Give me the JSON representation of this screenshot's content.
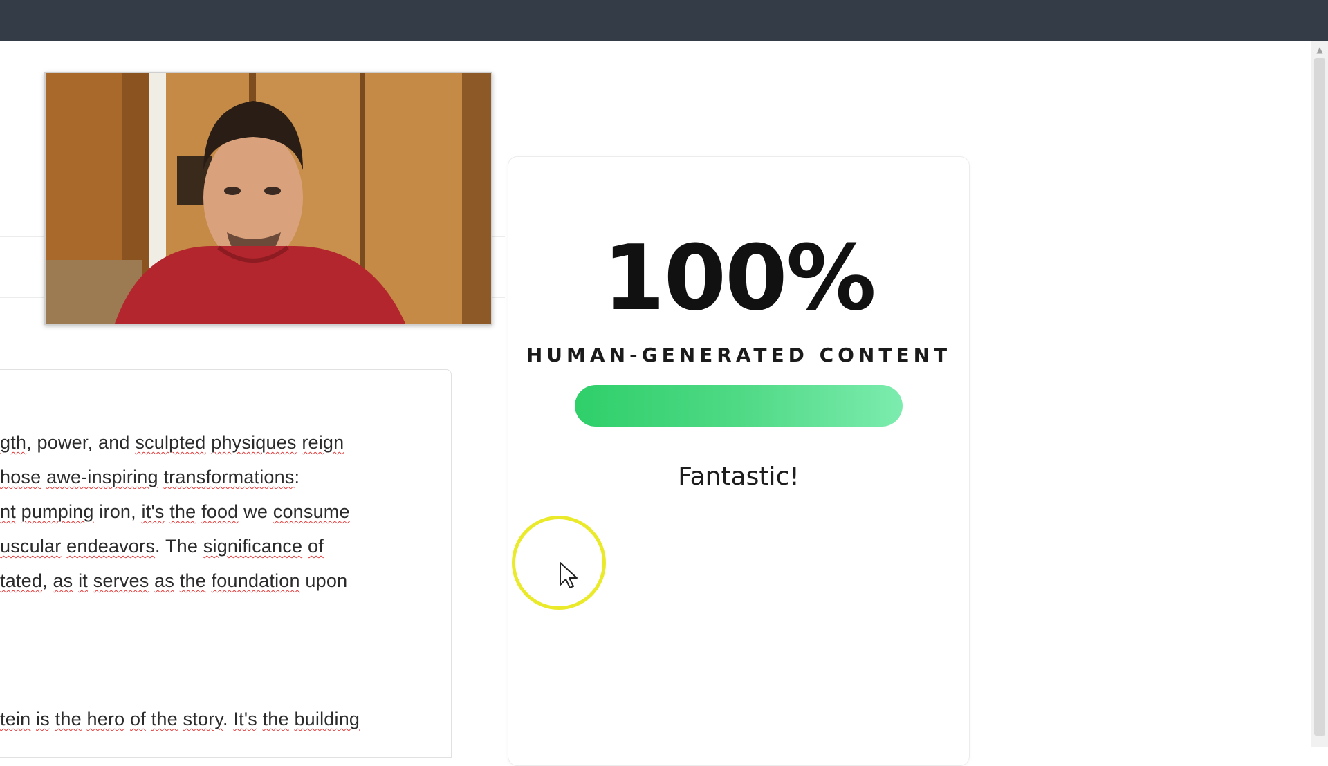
{
  "browser": {
    "topbar_color": "#343d47"
  },
  "editor": {
    "lines": [
      [
        {
          "t": "gth",
          "u": true
        },
        {
          "t": ", power, and ",
          "u": false
        },
        {
          "t": "sculpted",
          "u": true
        },
        {
          "t": " ",
          "u": false
        },
        {
          "t": "physiques",
          "u": true
        },
        {
          "t": " ",
          "u": false
        },
        {
          "t": "reign",
          "u": true
        }
      ],
      [
        {
          "t": "hose",
          "u": true
        },
        {
          "t": " ",
          "u": false
        },
        {
          "t": "awe-inspiring",
          "u": true
        },
        {
          "t": " ",
          "u": false
        },
        {
          "t": "transformations",
          "u": true
        },
        {
          "t": ":",
          "u": false
        }
      ],
      [
        {
          "t": "nt",
          "u": true
        },
        {
          "t": " ",
          "u": false
        },
        {
          "t": "pumping",
          "u": true
        },
        {
          "t": " iron, ",
          "u": false
        },
        {
          "t": "it's",
          "u": true
        },
        {
          "t": " ",
          "u": false
        },
        {
          "t": "the",
          "u": true
        },
        {
          "t": " ",
          "u": false
        },
        {
          "t": "food",
          "u": true
        },
        {
          "t": " we ",
          "u": false
        },
        {
          "t": "consume",
          "u": true
        }
      ],
      [
        {
          "t": "uscular",
          "u": true
        },
        {
          "t": " ",
          "u": false
        },
        {
          "t": "endeavors",
          "u": true
        },
        {
          "t": ". The ",
          "u": false
        },
        {
          "t": "significance",
          "u": true
        },
        {
          "t": " ",
          "u": false
        },
        {
          "t": "of",
          "u": true
        }
      ],
      [
        {
          "t": "tated",
          "u": true
        },
        {
          "t": ", ",
          "u": false
        },
        {
          "t": "as",
          "u": true
        },
        {
          "t": " ",
          "u": false
        },
        {
          "t": "it",
          "u": true
        },
        {
          "t": " ",
          "u": false
        },
        {
          "t": "serves",
          "u": true
        },
        {
          "t": " ",
          "u": false
        },
        {
          "t": "as",
          "u": true
        },
        {
          "t": " ",
          "u": false
        },
        {
          "t": "the",
          "u": true
        },
        {
          "t": " ",
          "u": false
        },
        {
          "t": "foundation",
          "u": true
        },
        {
          "t": " upon",
          "u": false
        }
      ],
      [
        {
          "t": "tein",
          "u": true
        },
        {
          "t": " ",
          "u": false
        },
        {
          "t": "is",
          "u": true
        },
        {
          "t": " ",
          "u": false
        },
        {
          "t": "the",
          "u": true
        },
        {
          "t": " ",
          "u": false
        },
        {
          "t": "hero",
          "u": true
        },
        {
          "t": " ",
          "u": false
        },
        {
          "t": "of",
          "u": true
        },
        {
          "t": " ",
          "u": false
        },
        {
          "t": "the",
          "u": true
        },
        {
          "t": " ",
          "u": false
        },
        {
          "t": "story",
          "u": true
        },
        {
          "t": ". ",
          "u": false
        },
        {
          "t": "It's",
          "u": true
        },
        {
          "t": " ",
          "u": false
        },
        {
          "t": "the",
          "u": true
        },
        {
          "t": " ",
          "u": false
        },
        {
          "t": "building",
          "u": true
        }
      ]
    ]
  },
  "result": {
    "score": "100%",
    "label": "HUMAN-GENERATED CONTENT",
    "bar_level": 1.0,
    "bar_color": "#3fd57a",
    "verdict": "Fantastic!"
  },
  "icons": {
    "cursor": "mouse-pointer-icon",
    "cursor_highlight_color": "#eaea2a",
    "scroll_up": "chevron-up-icon"
  }
}
